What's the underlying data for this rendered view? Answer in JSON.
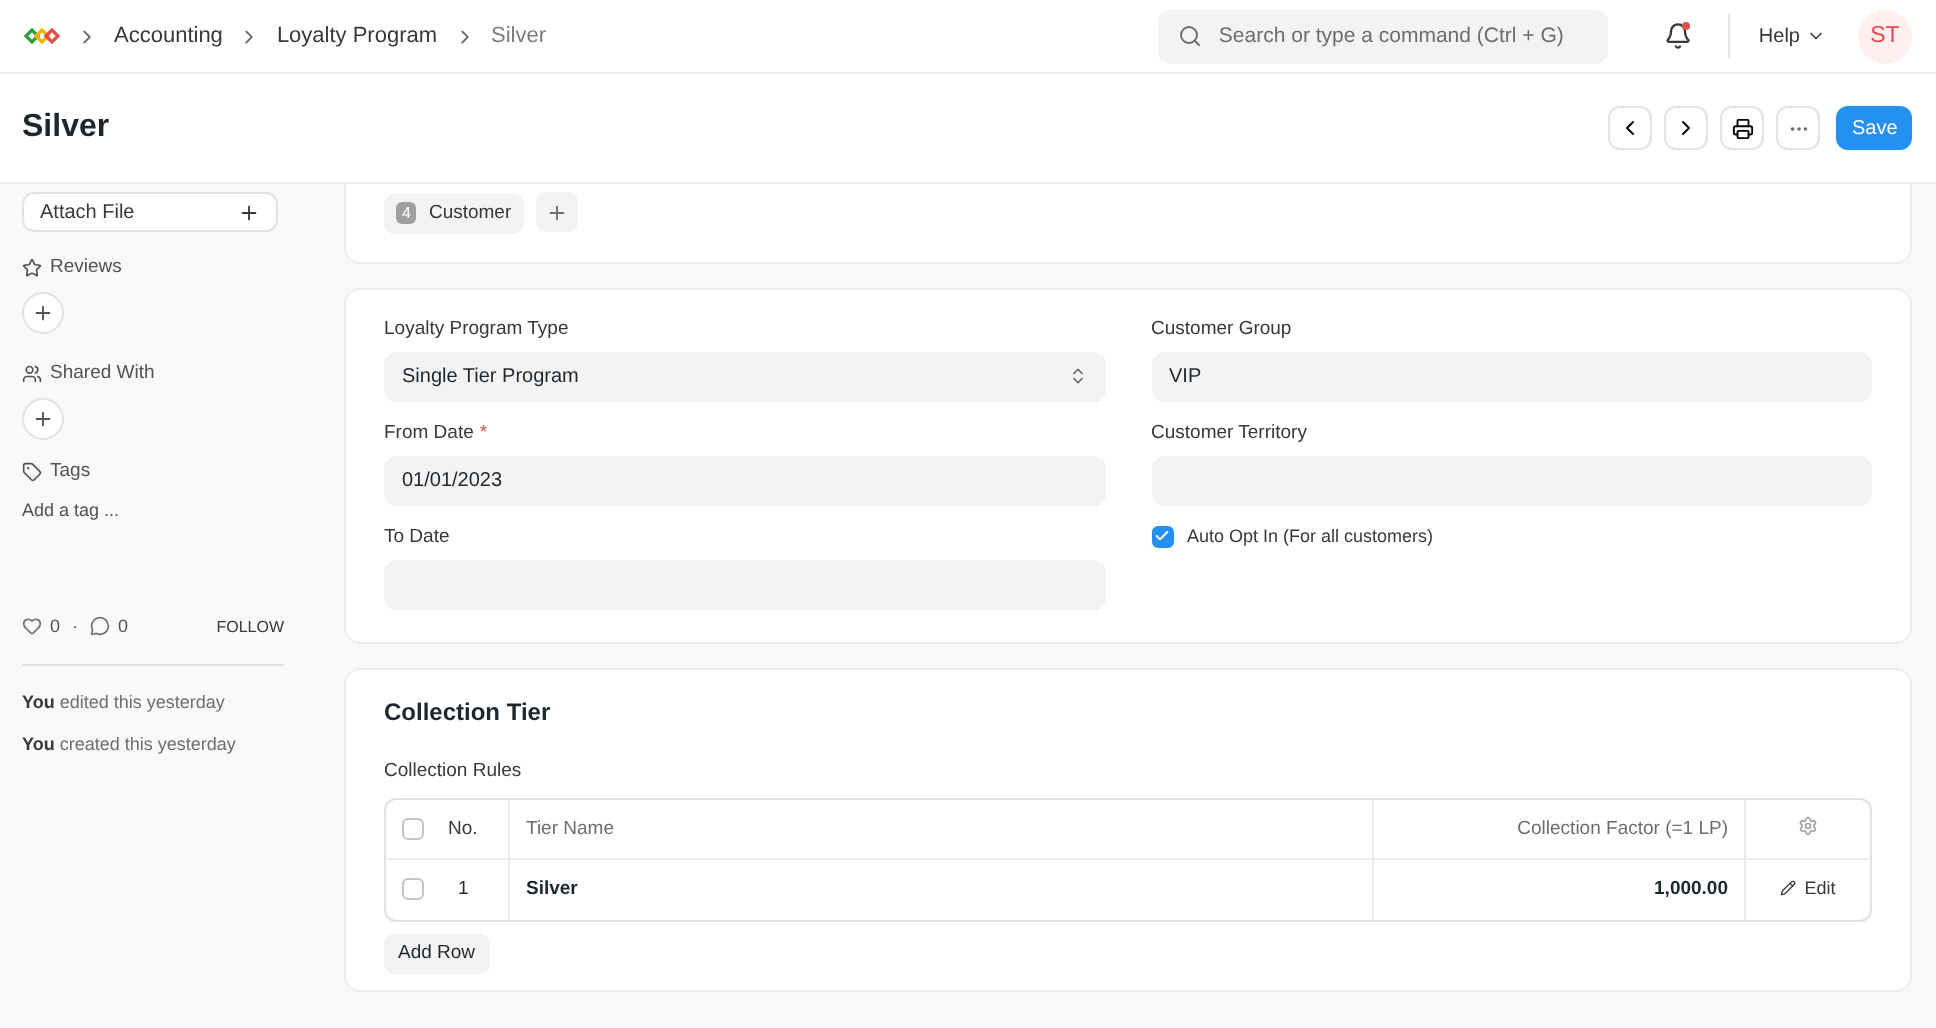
{
  "breadcrumbs": [
    "Accounting",
    "Loyalty Program",
    "Silver"
  ],
  "search": {
    "placeholder": "Search or type a command (Ctrl + G)"
  },
  "help": "Help",
  "avatar": "ST",
  "notification_unread": true,
  "title": "Silver",
  "save": "Save",
  "sidebar": {
    "attach": "Attach File",
    "reviews": "Reviews",
    "shared": "Shared With",
    "tags": "Tags",
    "add_tag": "Add a tag ...",
    "likes": "0",
    "separator": "·",
    "comments": "0",
    "follow": "FOLLOW",
    "activity": [
      {
        "who": "You",
        "text": "edited this yesterday"
      },
      {
        "who": "You",
        "text": "created this yesterday"
      }
    ]
  },
  "assigned": {
    "count": "4",
    "label": "Customer"
  },
  "form": {
    "left": [
      {
        "label": "Loyalty Program Type",
        "value": "Single Tier Program",
        "kind": "select"
      },
      {
        "label": "From Date",
        "value": "01/01/2023",
        "kind": "input",
        "required_mark": "*"
      },
      {
        "label": "To Date",
        "kind": "input"
      }
    ],
    "right": [
      {
        "label": "Customer Group",
        "value": "VIP",
        "kind": "input"
      },
      {
        "label": "Customer Territory",
        "kind": "input"
      },
      {
        "label": "Auto Opt In (For all customers)",
        "kind": "checkbox",
        "checked": true
      }
    ]
  },
  "section": {
    "title": "Collection Tier",
    "table_label": "Collection Rules",
    "all_checked": false,
    "columns": [
      "No.",
      "Tier Name",
      "Collection Factor (=1 LP)"
    ],
    "rows": [
      {
        "no": "1",
        "name": "Silver",
        "factor": "1,000.00",
        "edit": "Edit",
        "checked": false
      }
    ],
    "add_row": "Add Row"
  }
}
